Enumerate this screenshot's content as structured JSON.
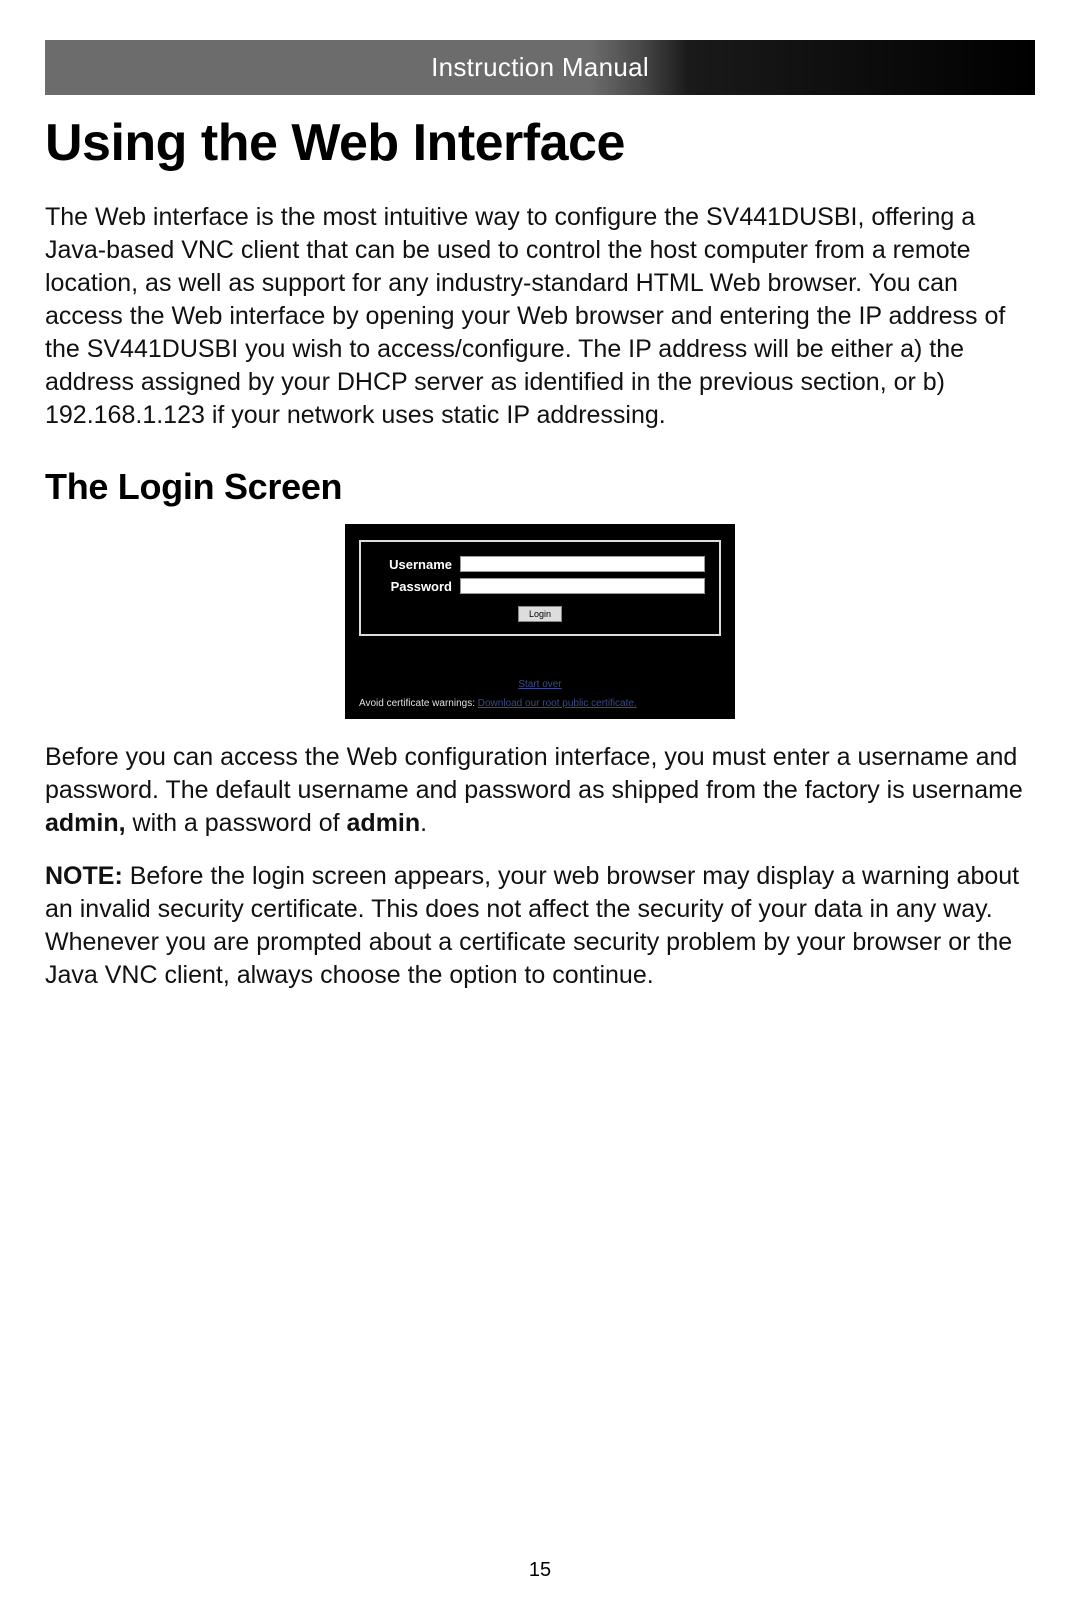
{
  "header": {
    "title": "Instruction Manual"
  },
  "h1": "Using the Web Interface",
  "intro": "The Web interface is the most intuitive way to configure the SV441DUSBI, offering a Java-based VNC client that can be used to control the host computer from a remote location, as well as support for any industry-standard HTML Web browser. You can access the Web interface by opening your Web browser and entering the IP address of the SV441DUSBI you wish to access/configure. The IP address will be either a) the address assigned by your DHCP server as identified in the previous section, or b) 192.168.1.123 if your network uses static IP addressing.",
  "h2": "The Login Screen",
  "login": {
    "username_label": "Username",
    "password_label": "Password",
    "login_btn": "Login",
    "start_over": "Start over",
    "footer_lead": "Avoid certificate warnings: ",
    "footer_link": "Download our root public certificate."
  },
  "p2_lead": "Before you can access the Web configuration interface, you must enter a username and password. The default username and password as shipped from the factory is username ",
  "p2_bold1": "admin,",
  "p2_mid": " with a password of ",
  "p2_bold2": "admin",
  "p2_end": ".",
  "note_label": "NOTE:",
  "note_body": " Before the login screen appears, your web browser may display a warning about an invalid security certificate. This does not affect the security of your data in any way. Whenever you are prompted about a certificate security problem by your browser or the Java VNC client, always choose the option to continue.",
  "page_number": "15"
}
